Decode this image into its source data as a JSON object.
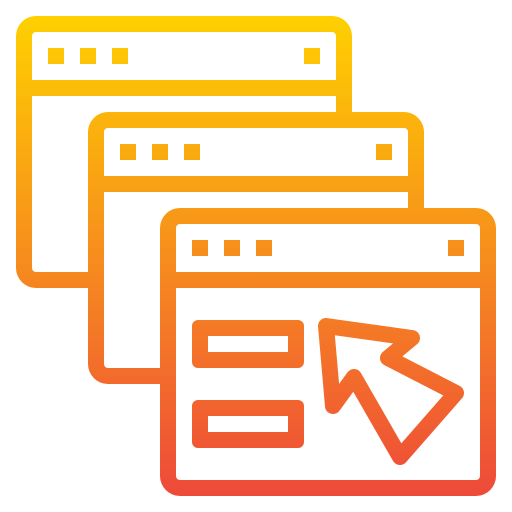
{
  "icon": {
    "name": "multiple-browser-windows-with-cursor-icon",
    "gradient_top": "#FFD000",
    "gradient_bottom": "#EE4A3A"
  }
}
